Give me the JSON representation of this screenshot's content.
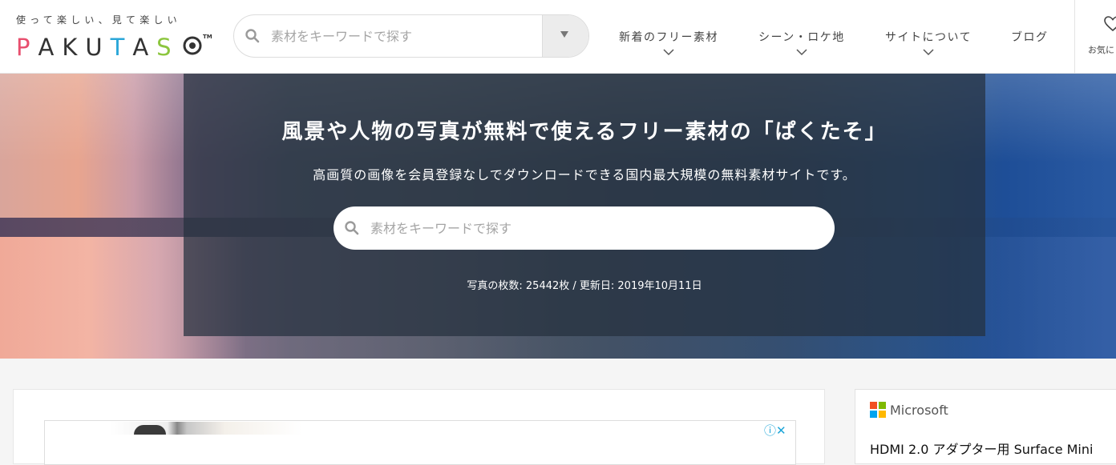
{
  "logo": {
    "tagline": "使って楽しい、見て楽しい",
    "letters": [
      "P",
      "A",
      "K",
      "U",
      "T",
      "A",
      "S"
    ],
    "letter_colors": [
      "#e84f6e",
      "#333333",
      "#333333",
      "#333333",
      "#2aa6d8",
      "#333333",
      "#8cc63e"
    ],
    "tm": "TM"
  },
  "header_search": {
    "placeholder": "素材をキーワードで探す"
  },
  "nav": {
    "items": [
      {
        "label": "新着のフリー素材"
      },
      {
        "label": "シーン・ロケ地"
      },
      {
        "label": "サイトについて"
      },
      {
        "label": "ブログ"
      }
    ],
    "favorites_label": "お気に"
  },
  "hero": {
    "title": "風景や人物の写真が無料で使えるフリー素材の「ぱくたそ」",
    "subtitle": "高画質の画像を会員登録なしでダウンロードできる国内最大規模の無料素材サイトです。",
    "search_placeholder": "素材をキーワードで探す",
    "stats": "写真の枚数: 25442枚 / 更新日: 2019年10月11日"
  },
  "ad": {
    "choices_label": "ⓘ✕"
  },
  "sidebar_ad": {
    "brand": "Microsoft",
    "product": "HDMI 2.0 アダプター用 Surface Mini",
    "brand_colors": [
      "#f25022",
      "#7fba00",
      "#00a4ef",
      "#ffb900"
    ]
  },
  "colors": {
    "accent_pink": "#e84f6e",
    "accent_blue": "#2aa6d8",
    "accent_green": "#8cc63e"
  }
}
